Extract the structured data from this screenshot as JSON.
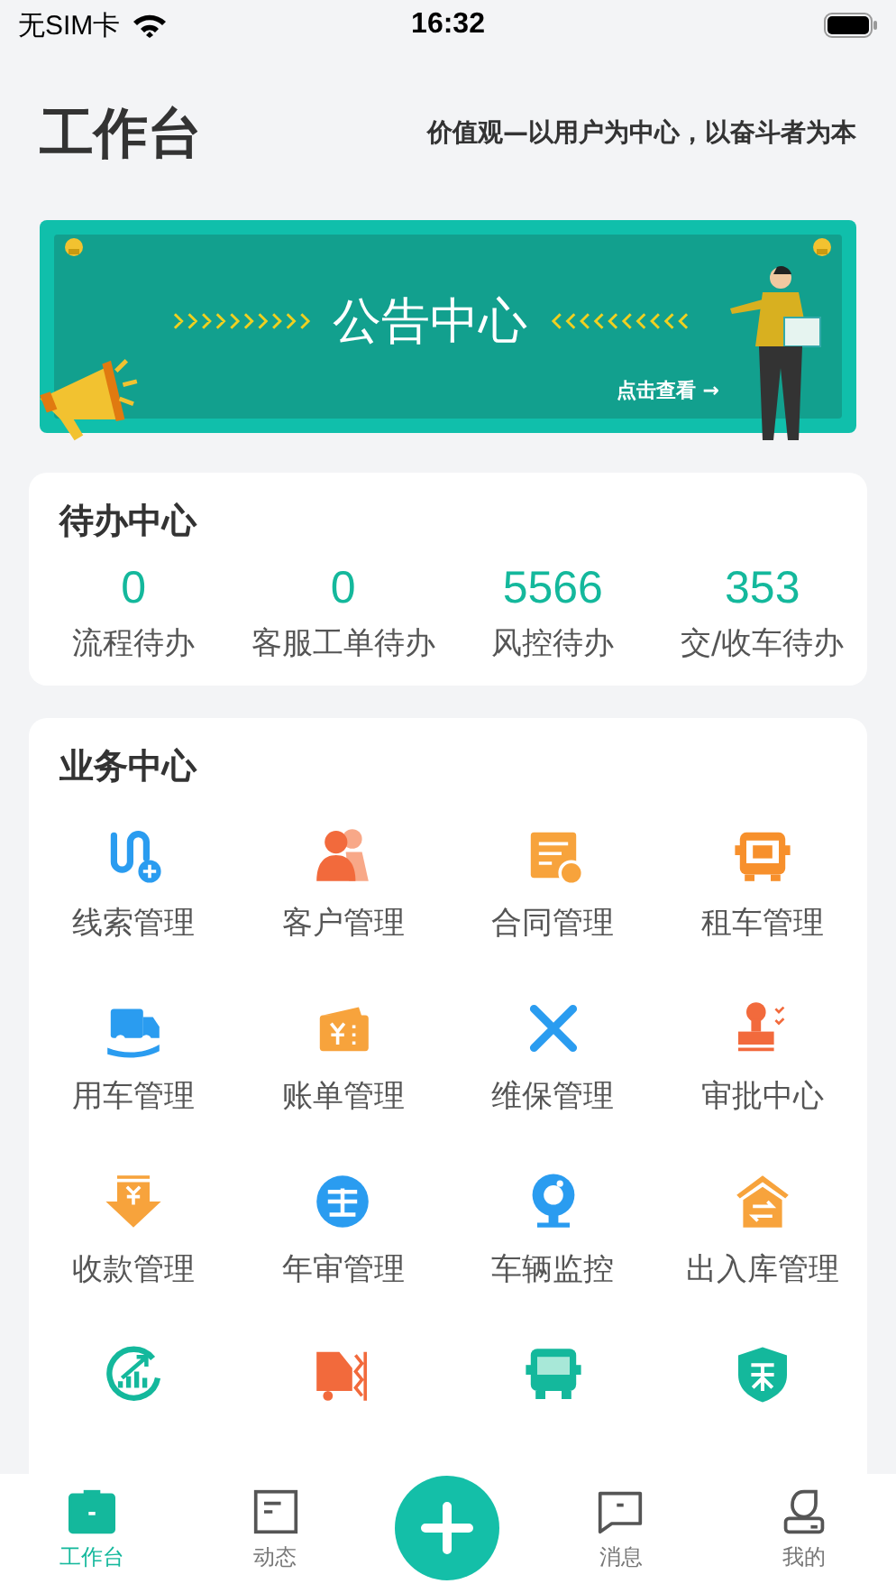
{
  "status_bar": {
    "carrier": "无SIM卡",
    "time": "16:32"
  },
  "header": {
    "title": "工作台",
    "motto": "价值观—以用户为中心，以奋斗者为本"
  },
  "banner": {
    "title": "公告中心",
    "link": "点击查看 →"
  },
  "todo": {
    "title": "待办中心",
    "items": [
      {
        "count": "0",
        "label": "流程待办"
      },
      {
        "count": "0",
        "label": "客服工单待办"
      },
      {
        "count": "5566",
        "label": "风控待办"
      },
      {
        "count": "353",
        "label": "交/收车待办"
      }
    ]
  },
  "business": {
    "title": "业务中心",
    "items": [
      {
        "kind": "labeled",
        "label": "线索管理"
      },
      {
        "kind": "labeled",
        "label": "客户管理"
      },
      {
        "kind": "labeled",
        "label": "合同管理"
      },
      {
        "kind": "labeled",
        "label": "租车管理"
      },
      {
        "kind": "labeled",
        "label": "用车管理"
      },
      {
        "kind": "labeled",
        "label": "账单管理"
      },
      {
        "kind": "labeled",
        "label": "维保管理"
      },
      {
        "kind": "labeled",
        "label": "审批中心"
      },
      {
        "kind": "labeled",
        "label": "收款管理"
      },
      {
        "kind": "labeled",
        "label": "年审管理"
      },
      {
        "kind": "labeled",
        "label": "车辆监控"
      },
      {
        "kind": "labeled",
        "label": "出入库管理"
      },
      {
        "kind": "icon_only"
      },
      {
        "kind": "icon_only"
      },
      {
        "kind": "icon_only"
      },
      {
        "kind": "icon_only"
      }
    ]
  },
  "tab_bar": [
    {
      "label": "工作台",
      "selected": true
    },
    {
      "label": "动态",
      "selected": false
    },
    {
      "kind": "add"
    },
    {
      "label": "消息",
      "selected": false
    },
    {
      "label": "我的",
      "selected": false
    }
  ]
}
